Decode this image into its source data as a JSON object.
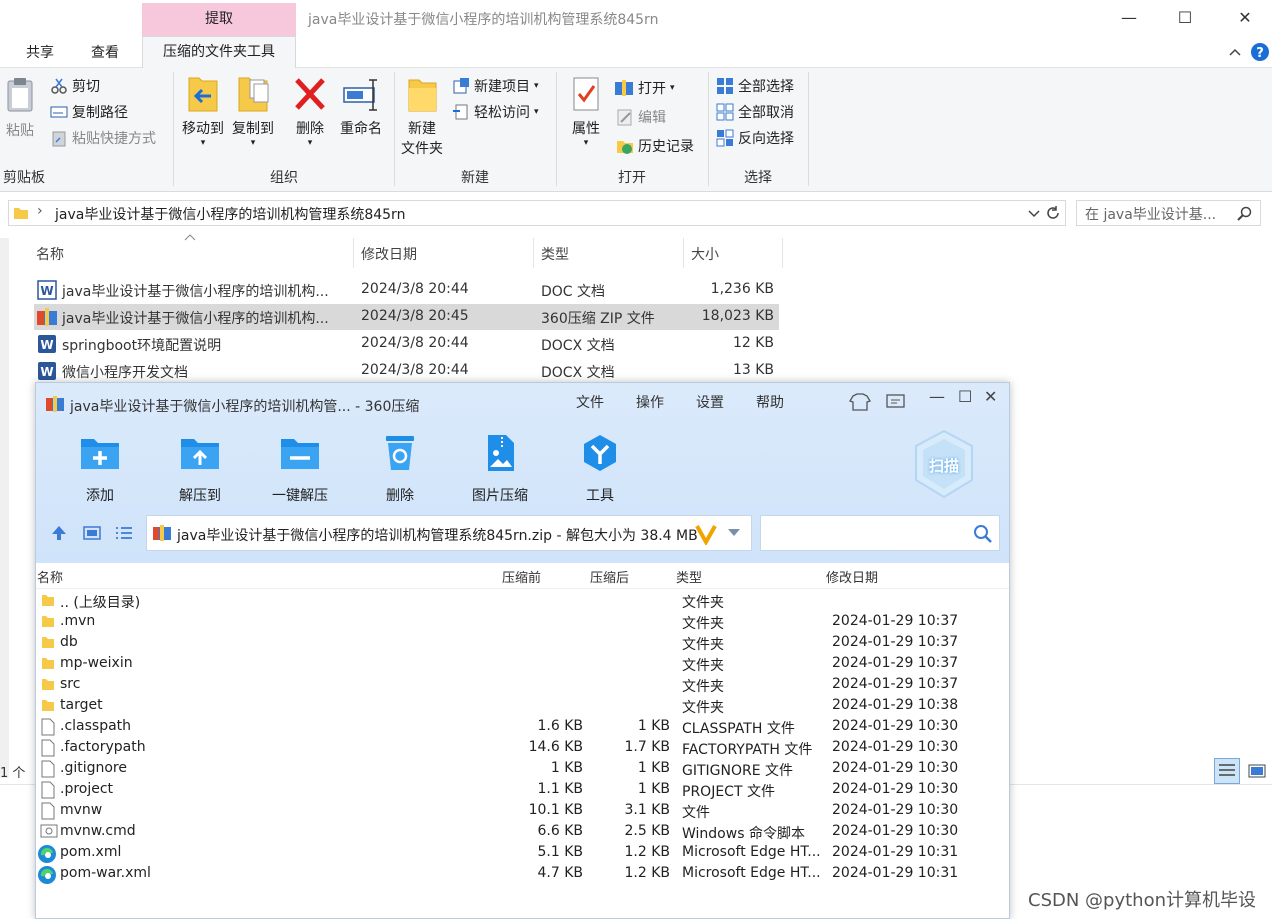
{
  "explorer": {
    "context_tab": "提取",
    "window_title": "java毕业设计基于微信小程序的培训机构管理系统845rn",
    "win_min": "—",
    "win_max": "☐",
    "win_close": "✕",
    "tabs": [
      "共享",
      "查看",
      "压缩的文件夹工具"
    ],
    "ribbon": {
      "clipboard": {
        "paste": "粘贴",
        "cut": "剪切",
        "copy_path": "复制路径",
        "paste_shortcut": "粘贴快捷方式",
        "label": "剪贴板"
      },
      "organize": {
        "move_to": "移动到",
        "copy_to": "复制到",
        "delete": "删除",
        "rename": "重命名",
        "label": "组织"
      },
      "new": {
        "new_folder_l1": "新建",
        "new_folder_l2": "文件夹",
        "new_item": "新建项目",
        "easy_access": "轻松访问",
        "label": "新建"
      },
      "open": {
        "properties": "属性",
        "open": "打开",
        "edit": "编辑",
        "history": "历史记录",
        "label": "打开"
      },
      "select": {
        "select_all": "全部选择",
        "select_none": "全部取消",
        "invert": "反向选择",
        "label": "选择"
      }
    },
    "address": "java毕业设计基于微信小程序的培训机构管理系统845rn",
    "search_placeholder": "在 java毕业设计基...",
    "columns": [
      "名称",
      "修改日期",
      "类型",
      "大小"
    ],
    "files": [
      {
        "name": "java毕业设计基于微信小程序的培训机构...",
        "date": "2024/3/8 20:44",
        "type": "DOC 文档",
        "size": "1,236 KB",
        "icon": "word",
        "selected": false
      },
      {
        "name": "java毕业设计基于微信小程序的培训机构...",
        "date": "2024/3/8 20:45",
        "type": "360压缩 ZIP 文件",
        "size": "18,023 KB",
        "icon": "zip",
        "selected": true
      },
      {
        "name": "springboot环境配置说明",
        "date": "2024/3/8 20:44",
        "type": "DOCX 文档",
        "size": "12 KB",
        "icon": "word",
        "selected": false
      },
      {
        "name": "微信小程序开发文档",
        "date": "2024/3/8 20:44",
        "type": "DOCX 文档",
        "size": "13 KB",
        "icon": "word",
        "selected": false
      }
    ],
    "status": "1 个"
  },
  "zip": {
    "title": "java毕业设计基于微信小程序的培训机构管... - 360压缩",
    "menus": [
      "文件",
      "操作",
      "设置",
      "帮助"
    ],
    "tools": [
      "添加",
      "解压到",
      "一键解压",
      "删除",
      "图片压缩",
      "工具"
    ],
    "scan": "扫描",
    "path": "java毕业设计基于微信小程序的培训机构管理系统845rn.zip - 解包大小为 38.4 MB",
    "columns": [
      "名称",
      "压缩前",
      "压缩后",
      "类型",
      "修改日期"
    ],
    "rows": [
      {
        "name": ".. (上级目录)",
        "before": "",
        "after": "",
        "type": "文件夹",
        "date": "",
        "icon": "folder"
      },
      {
        "name": ".mvn",
        "before": "",
        "after": "",
        "type": "文件夹",
        "date": "2024-01-29 10:37",
        "icon": "folder"
      },
      {
        "name": "db",
        "before": "",
        "after": "",
        "type": "文件夹",
        "date": "2024-01-29 10:37",
        "icon": "folder"
      },
      {
        "name": "mp-weixin",
        "before": "",
        "after": "",
        "type": "文件夹",
        "date": "2024-01-29 10:37",
        "icon": "folder"
      },
      {
        "name": "src",
        "before": "",
        "after": "",
        "type": "文件夹",
        "date": "2024-01-29 10:37",
        "icon": "folder"
      },
      {
        "name": "target",
        "before": "",
        "after": "",
        "type": "文件夹",
        "date": "2024-01-29 10:38",
        "icon": "folder"
      },
      {
        "name": ".classpath",
        "before": "1.6 KB",
        "after": "1 KB",
        "type": "CLASSPATH 文件",
        "date": "2024-01-29 10:30",
        "icon": "file"
      },
      {
        "name": ".factorypath",
        "before": "14.6 KB",
        "after": "1.7 KB",
        "type": "FACTORYPATH 文件",
        "date": "2024-01-29 10:30",
        "icon": "file"
      },
      {
        "name": ".gitignore",
        "before": "1 KB",
        "after": "1 KB",
        "type": "GITIGNORE 文件",
        "date": "2024-01-29 10:30",
        "icon": "file"
      },
      {
        "name": ".project",
        "before": "1.1 KB",
        "after": "1 KB",
        "type": "PROJECT 文件",
        "date": "2024-01-29 10:30",
        "icon": "file"
      },
      {
        "name": "mvnw",
        "before": "10.1 KB",
        "after": "3.1 KB",
        "type": "文件",
        "date": "2024-01-29 10:30",
        "icon": "file"
      },
      {
        "name": "mvnw.cmd",
        "before": "6.6 KB",
        "after": "2.5 KB",
        "type": "Windows 命令脚本",
        "date": "2024-01-29 10:30",
        "icon": "cmd"
      },
      {
        "name": "pom.xml",
        "before": "5.1 KB",
        "after": "1.2 KB",
        "type": "Microsoft Edge HT...",
        "date": "2024-01-29 10:31",
        "icon": "edge"
      },
      {
        "name": "pom-war.xml",
        "before": "4.7 KB",
        "after": "1.2 KB",
        "type": "Microsoft Edge HT...",
        "date": "2024-01-29 10:31",
        "icon": "edge"
      }
    ]
  },
  "watermark": "CSDN @python计算机毕设"
}
